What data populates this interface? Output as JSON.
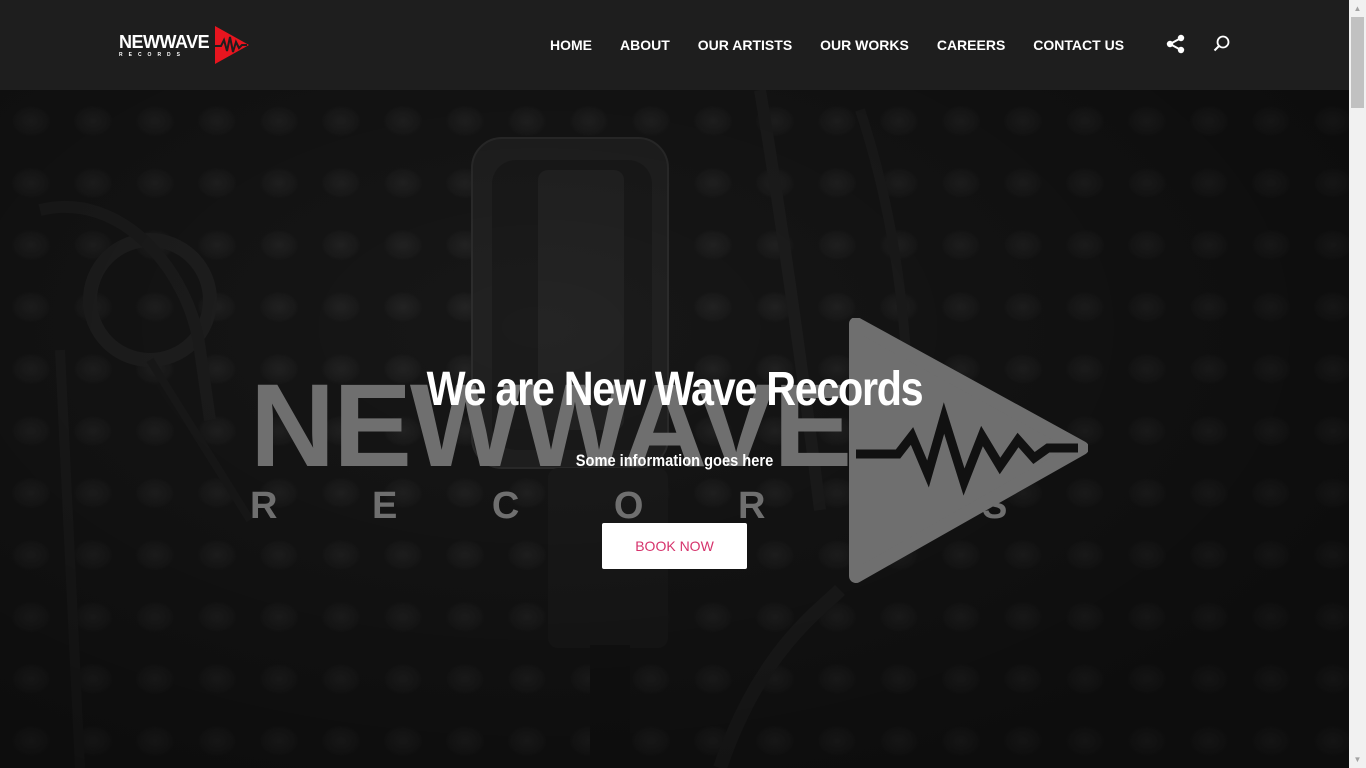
{
  "brand": {
    "name": "NEWWAVE",
    "tagline": "RECORDS",
    "accent": "#e8151f"
  },
  "nav": {
    "items": [
      {
        "label": "HOME"
      },
      {
        "label": "ABOUT"
      },
      {
        "label": "OUR ARTISTS"
      },
      {
        "label": "OUR WORKS"
      },
      {
        "label": "CAREERS"
      },
      {
        "label": "CONTACT US"
      }
    ]
  },
  "header_icons": {
    "share": "share-icon",
    "search": "search-icon"
  },
  "hero": {
    "title": "We are New Wave Records",
    "subtitle": "Some information goes here",
    "cta_label": "BOOK NOW",
    "cta_color": "#d6336c",
    "watermark_main": "NEWWAVE",
    "watermark_sub": "R E C O R D S"
  }
}
